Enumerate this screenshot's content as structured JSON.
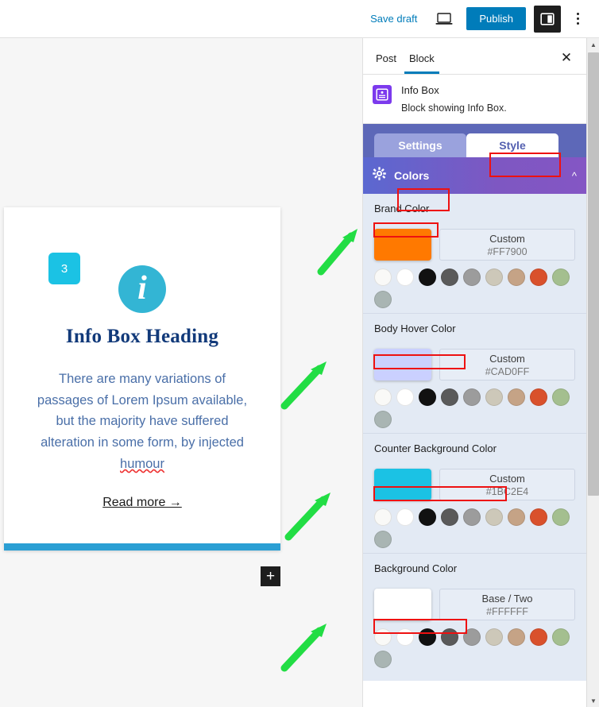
{
  "topbar": {
    "save_draft_label": "Save draft",
    "preview_icon": "laptop-preview-icon",
    "publish_label": "Publish",
    "sidebar_toggle_icon": "settings-sidebar-icon",
    "more_icon": "three-dots-vertical-icon"
  },
  "canvas": {
    "card": {
      "counter": "3",
      "info_icon": "info-i-icon",
      "heading": "Info Box Heading",
      "body_text": "There are many variations of passages of Lorem Ipsum available, but the majority have suffered alteration in some form, by injected ",
      "body_text_misspelled": "humour",
      "read_more_label": "Read more →",
      "add_block_label": "+"
    }
  },
  "sidebar": {
    "tabs": [
      {
        "label": "Post",
        "active": false
      },
      {
        "label": "Block",
        "active": true
      }
    ],
    "close_icon": "close-icon",
    "block": {
      "icon": "info-box-block-icon",
      "title": "Info Box",
      "description": "Block showing Info Box."
    },
    "panel_tabs": [
      {
        "label": "Settings",
        "active": false
      },
      {
        "label": "Style",
        "active": true
      }
    ],
    "panel": {
      "gear_icon": "gear-icon",
      "title": "Colors",
      "collapse_icon": "chevron-up-icon"
    },
    "palette": [
      "#f9f9f7",
      "#ffffff",
      "#111111",
      "#5a5a5a",
      "#9c9c9c",
      "#cdc8b9",
      "#c5a386",
      "#d9512c",
      "#a4bf8f",
      "#a9b5b3"
    ],
    "color_fields": [
      {
        "label": "Brand Color",
        "swatch": "#FF7900",
        "value_name": "Custom",
        "value_hex": "#FF7900"
      },
      {
        "label": "Body Hover Color",
        "swatch": "#CAD0FF",
        "value_name": "Custom",
        "value_hex": "#CAD0FF"
      },
      {
        "label": "Counter Background Color",
        "swatch": "#1BC2E4",
        "value_name": "Custom",
        "value_hex": "#1BC2E4"
      },
      {
        "label": "Background Color",
        "swatch": "#FFFFFF",
        "value_name": "Base / Two",
        "value_hex": "#FFFFFF"
      }
    ]
  },
  "colors": {
    "accent_blue": "#007cba",
    "panel_gradient_start": "#5b68d0",
    "panel_gradient_end": "#8456c4",
    "annotation_red": "#ee1111",
    "annotation_green": "#22dd44",
    "card_counter_bg": "#1BC2E4",
    "card_heading": "#123a7a",
    "card_body": "#4a6fa8",
    "card_bottom_bar": "#2b9fd4"
  },
  "scrollbar": {
    "up_icon": "scroll-up-arrow-icon",
    "down_icon": "scroll-down-arrow-icon",
    "thumb": "scrollbar-thumb"
  }
}
